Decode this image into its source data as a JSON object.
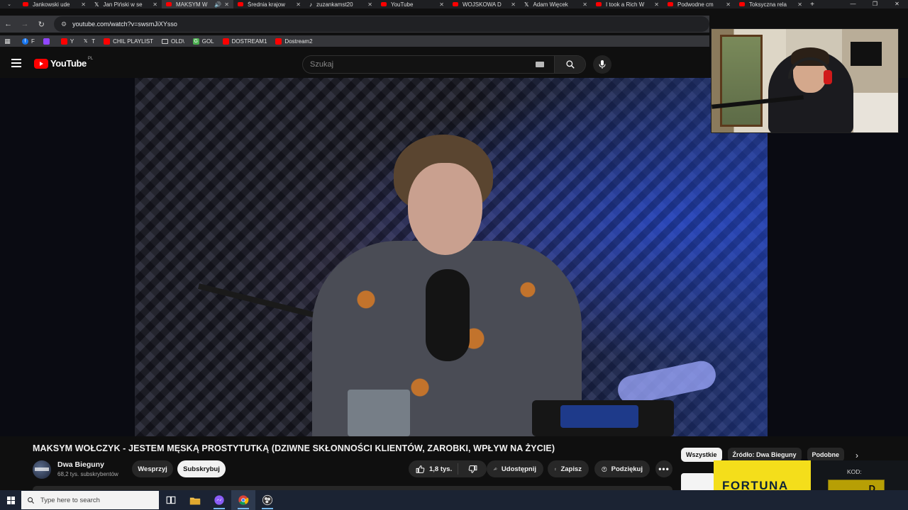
{
  "browser": {
    "tabs": [
      {
        "title": "Jankowski ude",
        "favicon": "youtube-icon",
        "active": false
      },
      {
        "title": "Jan Piński w se",
        "favicon": "x-icon",
        "active": false
      },
      {
        "title": "MAKSYM W",
        "favicon": "youtube-icon",
        "active": true,
        "audio": true
      },
      {
        "title": "Średnia krajow",
        "favicon": "youtube-icon",
        "active": false
      },
      {
        "title": "zuzankamst20",
        "favicon": "tiktok-icon",
        "active": false
      },
      {
        "title": "YouTube",
        "favicon": "youtube-icon",
        "active": false
      },
      {
        "title": "WOJSKOWA D",
        "favicon": "youtube-icon",
        "active": false
      },
      {
        "title": "Adam Więcek",
        "favicon": "x-icon",
        "active": false
      },
      {
        "title": "I took a Rich W",
        "favicon": "youtube-icon",
        "active": false
      },
      {
        "title": "Podwodne cm",
        "favicon": "youtube-icon",
        "active": false
      },
      {
        "title": "Toksyczna rela",
        "favicon": "youtube-icon",
        "active": false
      }
    ],
    "url": "youtube.com/watch?v=swsmJiXYsso",
    "bookmarks": [
      {
        "label": "",
        "icon": "apps-grid-icon"
      },
      {
        "label": "F",
        "icon": "facebook-icon"
      },
      {
        "label": "",
        "icon": "twitch-icon"
      },
      {
        "label": "Y",
        "icon": "youtube-icon"
      },
      {
        "label": "T",
        "icon": "x-icon"
      },
      {
        "label": "CHIL PLAYLIST",
        "icon": "youtube-icon"
      },
      {
        "label": "OLD\\",
        "icon": "folder-icon"
      },
      {
        "label": "GOL",
        "icon": "gol-icon"
      },
      {
        "label": "DOSTREAM1",
        "icon": "youtube-icon"
      },
      {
        "label": "Dostream2",
        "icon": "youtube-icon"
      }
    ]
  },
  "youtube": {
    "logo_text": "YouTube",
    "country_code": "PL",
    "search_placeholder": "Szukaj",
    "video": {
      "title": "MAKSYM WOŁCZYK - JESTEM MĘSKĄ PROSTYTUTKĄ (DZIWNE SKŁONNOŚCI KLIENTÓW, ZAROBKI, WPŁYW NA ŻYCIE)",
      "channel_name": "Dwa Bieguny",
      "subscribers": "68,2 tys. subskrybentów",
      "join_label": "Wesprzyj",
      "subscribe_label": "Subskrybuj",
      "likes": "1,8 tys.",
      "share_label": "Udostępnij",
      "save_label": "Zapisz",
      "thanks_label": "Podziękuj"
    },
    "chips": [
      "Wszystkie",
      "Źródło: Dwa Bieguny",
      "Podobne"
    ],
    "ad": {
      "brand": "FORTUNA",
      "code_label": "KOD:",
      "code_value": "D"
    }
  },
  "taskbar": {
    "search_placeholder": "Type here to search",
    "apps": [
      "task-view-icon",
      "file-explorer-icon",
      "messenger-icon",
      "chrome-icon",
      "obs-icon"
    ]
  },
  "colors": {
    "youtube_red": "#ff0000",
    "background": "#0f0f0f",
    "ad_yellow": "#f4de1b"
  }
}
